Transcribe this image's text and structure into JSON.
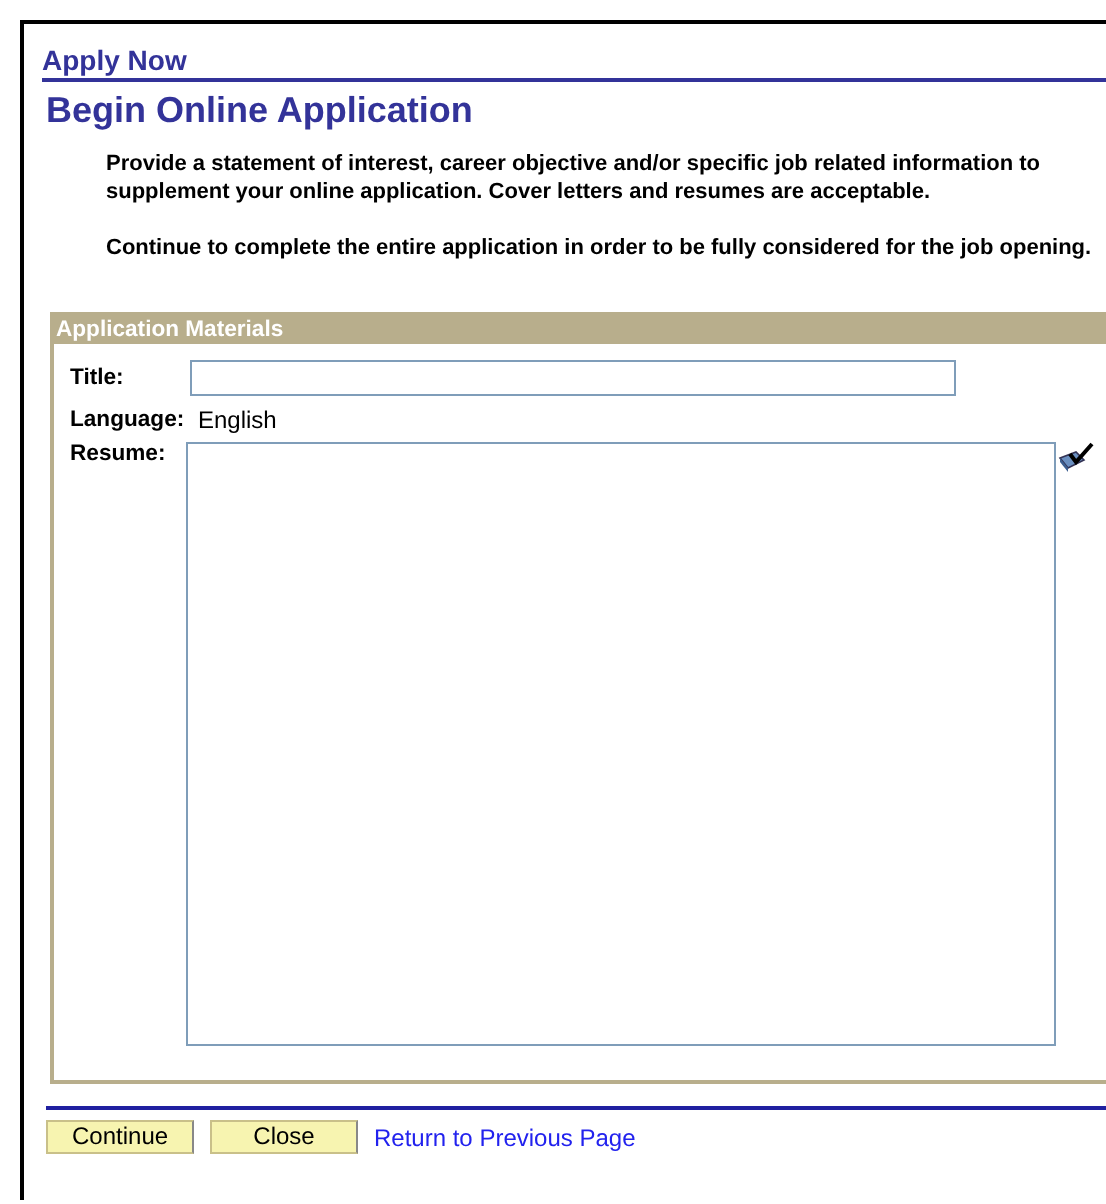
{
  "header": {
    "title": "Apply Now"
  },
  "page_title": "Begin Online Application",
  "instructions": [
    "Provide a statement of interest, career objective and/or specific job related information to supplement your online application. Cover letters and resumes are acceptable.",
    "Continue to complete the entire application in order to be fully considered for the job opening."
  ],
  "group": {
    "title": "Application Materials",
    "fields": [
      {
        "kind": "input",
        "label": "Title:"
      },
      {
        "kind": "text",
        "label": "Language:",
        "value": "English"
      },
      {
        "kind": "textarea",
        "label": "Resume:"
      }
    ]
  },
  "buttons": [
    "Continue",
    "Close"
  ],
  "link": "Return to Previous Page"
}
